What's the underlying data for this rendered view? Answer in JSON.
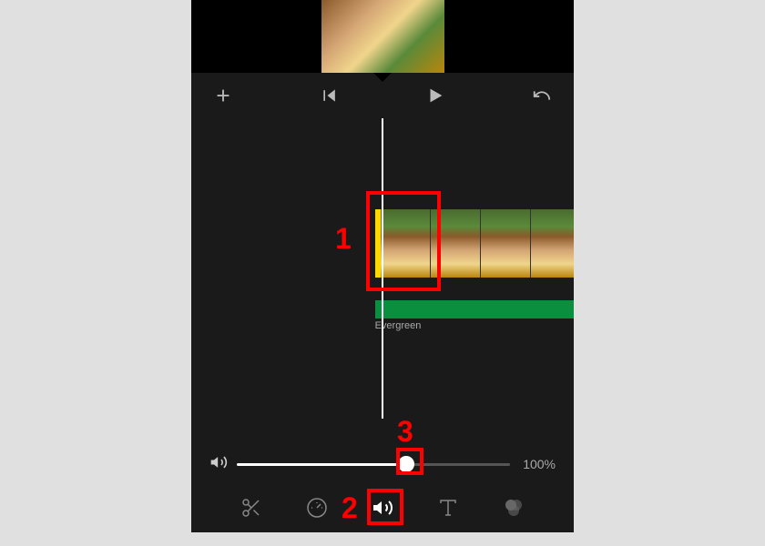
{
  "audio": {
    "track_label": "Evergreen"
  },
  "volume": {
    "value_label": "100%",
    "percent": 62
  },
  "annotations": {
    "one": "1",
    "two": "2",
    "three": "3"
  },
  "tools": {
    "cut": "cut",
    "speed": "speed",
    "volume": "volume",
    "text": "text",
    "filter": "filter"
  }
}
